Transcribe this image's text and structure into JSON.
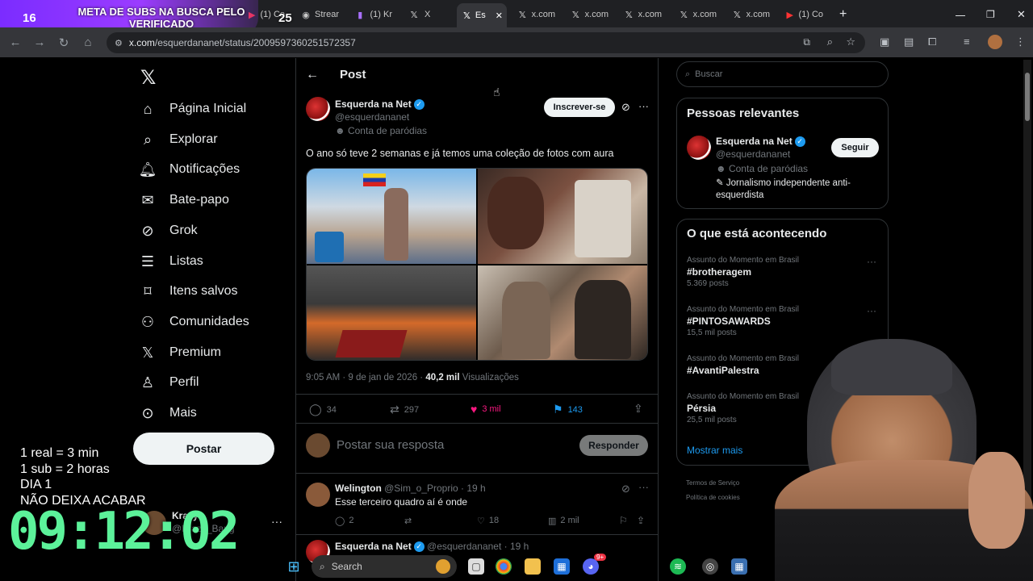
{
  "browser": {
    "tabs": [
      {
        "label": "(1) Co"
      },
      {
        "label": "Strear"
      },
      {
        "label": "(1) Kr"
      },
      {
        "label": "X"
      },
      {
        "label": "Es"
      },
      {
        "label": "x.com"
      },
      {
        "label": "x.com"
      },
      {
        "label": "x.com"
      },
      {
        "label": "x.com"
      },
      {
        "label": "x.com"
      },
      {
        "label": "(1) Co"
      }
    ],
    "url_host": "x.com",
    "url_path": "/esquerdananet/status/2009597360251572357"
  },
  "overlay": {
    "count_left": "16",
    "count_right": "25",
    "goal_text": "META DE SUBS NA BUSCA PELO VERIFICADO",
    "rules": [
      "1 real = 3 min",
      "1 sub = 2 horas",
      "DIA 1",
      "NÃO DEIXA ACABAR"
    ],
    "timer": "09:12:02"
  },
  "nav": {
    "items": [
      {
        "label": "Página Inicial"
      },
      {
        "label": "Explorar"
      },
      {
        "label": "Notificações"
      },
      {
        "label": "Bate-papo"
      },
      {
        "label": "Grok"
      },
      {
        "label": "Listas"
      },
      {
        "label": "Itens salvos"
      },
      {
        "label": "Comunidades"
      },
      {
        "label": "Premium"
      },
      {
        "label": "Perfil"
      },
      {
        "label": "Mais"
      }
    ],
    "post_button": "Postar",
    "account_name": "Krazy",
    "account_handle": "@Krazy_Bang"
  },
  "post": {
    "header": "Post",
    "author_name": "Esquerda na Net",
    "author_handle": "@esquerdananet",
    "parody_label": "Conta de paródias",
    "subscribe_button": "Inscrever-se",
    "text": "O ano só teve 2 semanas e já temos uma coleção de fotos com aura",
    "time": "9:05 AM · 9 de jan de 2026 ·",
    "views_count": "40,2 mil",
    "views_label": "Visualizações",
    "replies": "34",
    "reposts": "297",
    "likes": "3 mil",
    "bookmarks": "143",
    "reply_placeholder": "Postar sua resposta",
    "reply_button": "Responder"
  },
  "reply": {
    "name": "Welington",
    "handle": "@Sim_o_Proprio · 19 h",
    "text": "Esse terceiro quadro aí é onde",
    "replies": "2",
    "likes": "18",
    "views": "2 mil",
    "next_name": "Esquerda na Net",
    "next_handle": "@esquerdananet · 19 h"
  },
  "sidebar": {
    "search_placeholder": "Buscar",
    "relevant_title": "Pessoas relevantes",
    "relevant_name": "Esquerda na Net",
    "relevant_handle": "@esquerdananet",
    "relevant_parody": "Conta de paródias",
    "relevant_bio": "Jornalismo independente anti-esquerdista",
    "follow_button": "Seguir",
    "trending_title": "O que está acontecendo",
    "trends": [
      {
        "context": "Assunto do Momento em Brasil",
        "name": "#brotheragem",
        "count": "5.369 posts"
      },
      {
        "context": "Assunto do Momento em Brasil",
        "name": "#PINTOSAWARDS",
        "count": "15,5 mil posts"
      },
      {
        "context": "Assunto do Momento em Brasil",
        "name": "#AvantiPalestra",
        "count": ""
      },
      {
        "context": "Assunto do Momento em Brasil",
        "name": "Pérsia",
        "count": "25,5 mil posts"
      }
    ],
    "show_more": "Mostrar mais",
    "footer_1": "Termos de Serviço",
    "footer_2": "Política de cookies"
  },
  "taskbar": {
    "search_label": "Search",
    "discord_badge": "9+"
  },
  "colors": {
    "accent": "#1d9bf0",
    "like": "#f91880",
    "timer": "#5cf29a",
    "banner": "#8a34ff"
  }
}
